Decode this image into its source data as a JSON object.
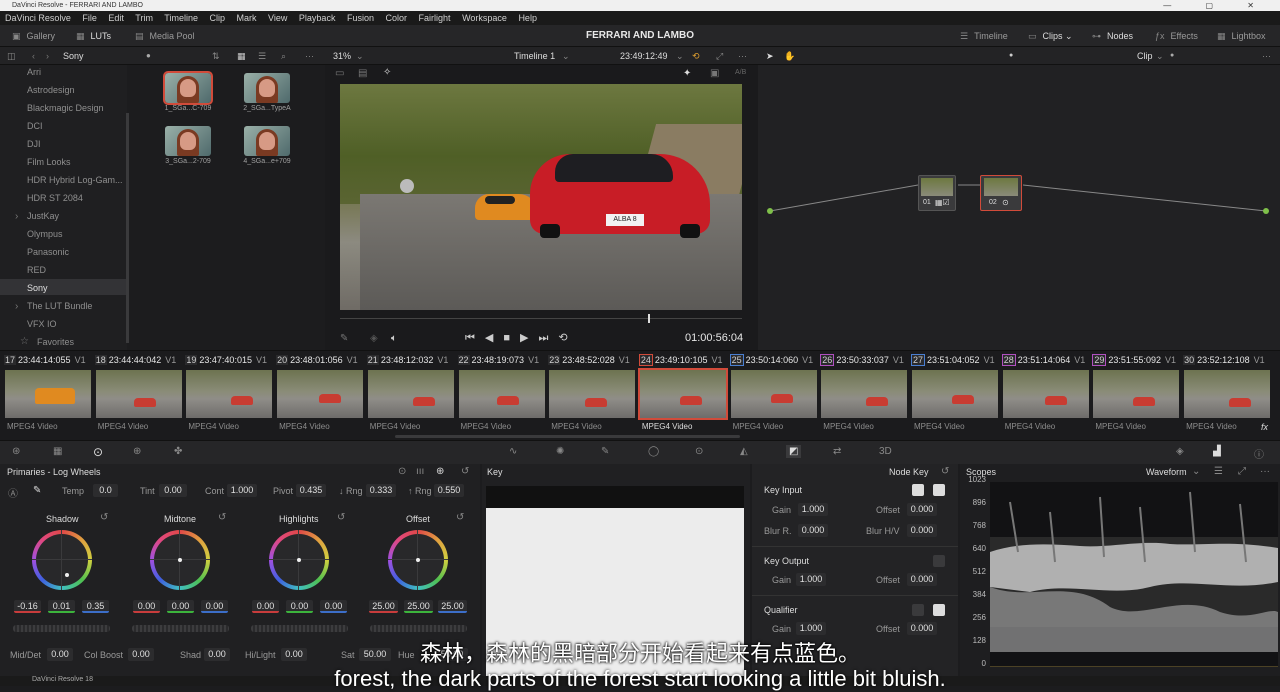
{
  "window": {
    "title": "DaVinci Resolve - FERRARI AND LAMBO",
    "controls": "—  ▢  ✕"
  },
  "menu": [
    "DaVinci Resolve",
    "File",
    "Edit",
    "Trim",
    "Timeline",
    "Clip",
    "Mark",
    "View",
    "Playback",
    "Fusion",
    "Color",
    "Fairlight",
    "Workspace",
    "Help"
  ],
  "toolbar": {
    "gallery": "Gallery",
    "luts": "LUTs",
    "media_pool": "Media Pool",
    "project": "FERRARI AND LAMBO",
    "timeline": "Timeline",
    "clips": "Clips",
    "nodes": "Nodes",
    "effects": "Effects",
    "lightbox": "Lightbox"
  },
  "subbar": {
    "folder": "Sony",
    "zoom": "31%",
    "timeline_name": "Timeline 1",
    "timecode": "23:49:12:49",
    "mode": "Clip"
  },
  "lut_folders": [
    "Arri",
    "Astrodesign",
    "Blackmagic Design",
    "DCI",
    "DJI",
    "Film Looks",
    "HDR Hybrid Log-Gam...",
    "HDR ST 2084",
    "JustKay",
    "Olympus",
    "Panasonic",
    "RED",
    "Sony",
    "The LUT Bundle",
    "VFX IO",
    "Favorites"
  ],
  "lut_thumbs": [
    "1_SGa...C-709",
    "2_SGa...TypeA",
    "3_SGa...2-709",
    "4_SGa...e+709"
  ],
  "viewer": {
    "timecode": "01:00:56:04",
    "ab": "A/B",
    "plate": "ALBA 8"
  },
  "nodes": [
    {
      "label": "01"
    },
    {
      "label": "02"
    }
  ],
  "clips": [
    {
      "num": "17",
      "tc": "23:44:14:055",
      "track": "V1",
      "type": "MPEG4 Video"
    },
    {
      "num": "18",
      "tc": "23:44:44:042",
      "track": "V1",
      "type": "MPEG4 Video"
    },
    {
      "num": "19",
      "tc": "23:47:40:015",
      "track": "V1",
      "type": "MPEG4 Video"
    },
    {
      "num": "20",
      "tc": "23:48:01:056",
      "track": "V1",
      "type": "MPEG4 Video"
    },
    {
      "num": "21",
      "tc": "23:48:12:032",
      "track": "V1",
      "type": "MPEG4 Video"
    },
    {
      "num": "22",
      "tc": "23:48:19:073",
      "track": "V1",
      "type": "MPEG4 Video"
    },
    {
      "num": "23",
      "tc": "23:48:52:028",
      "track": "V1",
      "type": "MPEG4 Video"
    },
    {
      "num": "24",
      "tc": "23:49:10:105",
      "track": "V1",
      "type": "MPEG4 Video"
    },
    {
      "num": "25",
      "tc": "23:50:14:060",
      "track": "V1",
      "type": "MPEG4 Video"
    },
    {
      "num": "26",
      "tc": "23:50:33:037",
      "track": "V1",
      "type": "MPEG4 Video"
    },
    {
      "num": "27",
      "tc": "23:51:04:052",
      "track": "V1",
      "type": "MPEG4 Video"
    },
    {
      "num": "28",
      "tc": "23:51:14:064",
      "track": "V1",
      "type": "MPEG4 Video"
    },
    {
      "num": "29",
      "tc": "23:51:55:092",
      "track": "V1",
      "type": "MPEG4 Video"
    },
    {
      "num": "30",
      "tc": "23:52:12:108",
      "track": "V1",
      "type": "MPEG4 Video"
    }
  ],
  "primaries": {
    "title": "Primaries - Log Wheels",
    "temp_l": "Temp",
    "temp": "0.0",
    "tint_l": "Tint",
    "tint": "0.00",
    "cont_l": "Cont",
    "cont": "1.000",
    "pivot_l": "Pivot",
    "pivot": "0.435",
    "lrng_l": "↓ Rng",
    "lrng": "0.333",
    "hrng_l": "↑ Rng",
    "hrng": "0.550",
    "wheels": [
      {
        "name": "Shadow",
        "v": [
          "-0.16",
          "0.01",
          "0.35"
        ]
      },
      {
        "name": "Midtone",
        "v": [
          "0.00",
          "0.00",
          "0.00"
        ]
      },
      {
        "name": "Highlights",
        "v": [
          "0.00",
          "0.00",
          "0.00"
        ]
      },
      {
        "name": "Offset",
        "v": [
          "25.00",
          "25.00",
          "25.00"
        ]
      }
    ],
    "middet_l": "Mid/Det",
    "middet": "0.00",
    "colboost_l": "Col Boost",
    "colboost": "0.00",
    "shad_l": "Shad",
    "shad": "0.00",
    "hilight_l": "Hi/Light",
    "hilight": "0.00",
    "sat_l": "Sat",
    "sat": "50.00",
    "hue_l": "Hue",
    "hue": "50.00"
  },
  "key": {
    "title": "Key",
    "node_key": "Node Key",
    "key_input": "Key Input",
    "gain_l": "Gain",
    "gain": "1.000",
    "offset_l": "Offset",
    "offset": "0.000",
    "blurr_l": "Blur R.",
    "blurr": "0.000",
    "blurhv_l": "Blur H/V",
    "blurhv": "0.000",
    "key_output": "Key Output",
    "kogain": "1.000",
    "kooffset": "0.000",
    "qualifier": "Qualifier",
    "qgain": "1.000",
    "qoffset": "0.000"
  },
  "scopes": {
    "title": "Scopes",
    "mode": "Waveform",
    "ticks": [
      "1023",
      "896",
      "768",
      "640",
      "512",
      "384",
      "256",
      "128",
      "0"
    ]
  },
  "subtitle": {
    "zh": "森林，森林的黑暗部分开始看起来有点蓝色。",
    "en": "forest, the dark parts of the forest start looking a little bit bluish."
  },
  "status": {
    "app": "DaVinci Resolve 18"
  }
}
